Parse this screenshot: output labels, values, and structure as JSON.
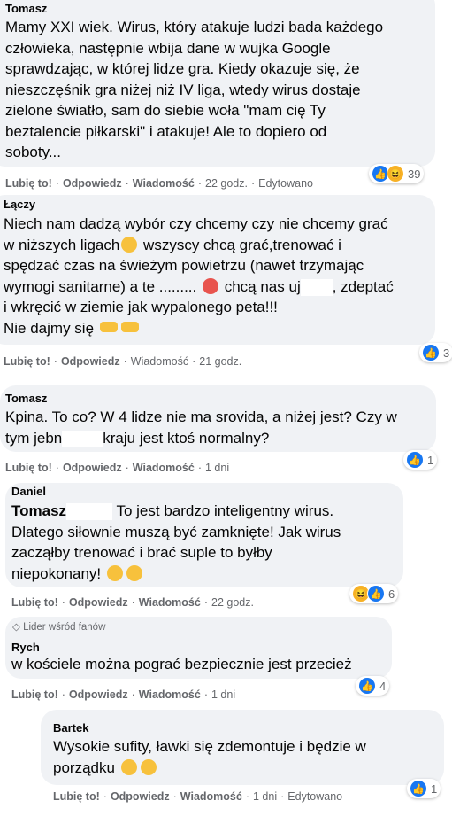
{
  "comments": [
    {
      "author": "Tomasz",
      "lines": [
        "Mamy XXI wiek. Wirus, który atakuje ludzi bada każdego",
        "człowieka, następnie wbija dane w wujka Google",
        "sprawdzając, w której lidze gra. Kiedy okazuje się, że",
        "nieszczęśnik gra niżej niż IV liga, wtedy wirus dostaje",
        "zielone światło, sam do siebie woła \"mam cię Ty",
        "beztalencie piłkarski\" i atakuje! Ale to dopiero od",
        "soboty..."
      ],
      "actions": {
        "like": "Lubię to!",
        "reply": "Odpowiedz",
        "message": "Wiadomość",
        "time": "22 godz.",
        "edited": "Edytowano"
      },
      "reactions": {
        "count": "39"
      }
    },
    {
      "author": "Łączy",
      "lines": [
        "Niech nam dadzą wybór czy chcemy czy nie chcemy grać",
        "w niższych ligach",
        " wszyscy chcą grać,trenować i",
        "spędzać czas na świeżym powietrzu (nawet trzymając",
        "wymogi sanitarne) a te .........",
        " chcą nas uj",
        ", zdeptać",
        "i wkręcić w ziemie jak wypalonego peta!!!",
        "Nie dajmy się"
      ],
      "actions": {
        "like": "Lubię to!",
        "reply": "Odpowiedz",
        "message": "Wiadomość",
        "time": "21 godz."
      },
      "reactions": {
        "count": "3"
      }
    },
    {
      "author": "Tomasz",
      "lines": [
        "Kpina. To co? W 4 lidze nie ma srovida, a niżej jest? Czy w",
        "tym jebn",
        "kraju jest ktoś normalny?"
      ],
      "actions": {
        "like": "Lubię to!",
        "reply": "Odpowiedz",
        "message": "Wiadomość",
        "time": "1 dni"
      },
      "reactions": {
        "count": "1"
      }
    },
    {
      "author": "Daniel",
      "mention": "Tomasz",
      "lines": [
        "To jest bardzo inteligentny wirus.",
        "Dlatego siłownie muszą być zamknięte! Jak wirus",
        "zacząłby trenować i brać suple to byłby",
        "niepokonany!"
      ],
      "actions": {
        "like": "Lubię to!",
        "reply": "Odpowiedz",
        "message": "Wiadomość",
        "time": "22 godz."
      },
      "reactions": {
        "count": "6"
      }
    },
    {
      "badge": "Lider wśród fanów",
      "author": "Rych",
      "lines": [
        "w kościele można pograć bezpiecznie jest przecież"
      ],
      "actions": {
        "like": "Lubię to!",
        "reply": "Odpowiedz",
        "message": "Wiadomość",
        "time": "1 dni"
      },
      "reactions": {
        "count": "4"
      }
    },
    {
      "author": "Bartek",
      "lines": [
        "Wysokie sufity, ławki się zdemontuje i będzie w",
        "porządku"
      ],
      "actions": {
        "like": "Lubię to!",
        "reply": "Odpowiedz",
        "message": "Wiadomość",
        "time": "1 dni",
        "edited": "Edytowano"
      },
      "reactions": {
        "count": "1"
      }
    }
  ]
}
